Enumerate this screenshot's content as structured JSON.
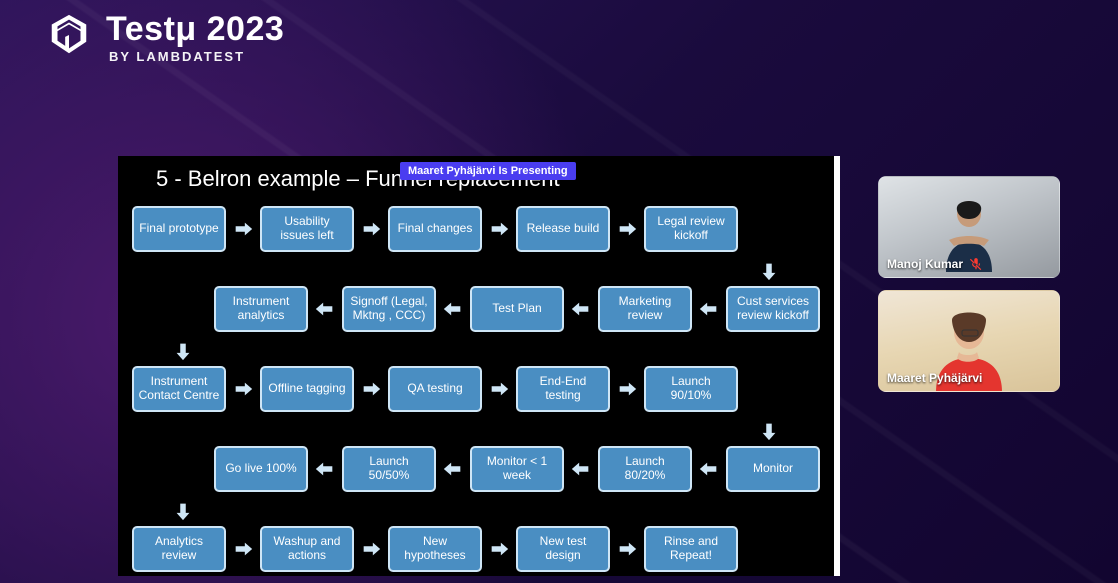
{
  "brand": {
    "title": "Testμ 2023",
    "subtitle": "BY LAMBDATEST"
  },
  "presenting_badge": "Maaret Pyhäjärvi Is Presenting",
  "slide": {
    "title": "5 - Belron example – Funnel replacement",
    "rows": [
      {
        "dir": "fwd",
        "boxes": [
          "Final prototype",
          "Usability issues left",
          "Final changes",
          "Release build",
          "Legal review kickoff"
        ]
      },
      {
        "dir": "rev",
        "boxes": [
          "Cust services review kickoff",
          "Marketing review",
          "Test Plan",
          "Signoff (Legal, Mktng , CCC)",
          "Instrument analytics"
        ]
      },
      {
        "dir": "fwd",
        "boxes": [
          "Instrument Contact Centre",
          "Offline tagging",
          "QA testing",
          "End-End testing",
          "Launch 90/10%"
        ]
      },
      {
        "dir": "rev",
        "boxes": [
          "Monitor",
          "Launch 80/20%",
          "Monitor < 1 week",
          "Launch 50/50%",
          "Go live 100%"
        ]
      },
      {
        "dir": "fwd",
        "boxes": [
          "Analytics review",
          "Washup and actions",
          "New hypotheses",
          "New test design",
          "Rinse and Repeat!"
        ]
      }
    ],
    "vlinks": [
      {
        "after_row": 0,
        "align": "end"
      },
      {
        "after_row": 1,
        "align": "start"
      },
      {
        "after_row": 2,
        "align": "end"
      },
      {
        "after_row": 3,
        "align": "start"
      }
    ]
  },
  "participants": [
    {
      "name": "Manoj Kumar",
      "muted": true
    },
    {
      "name": "Maaret Pyhäjärvi",
      "muted": false
    }
  ]
}
